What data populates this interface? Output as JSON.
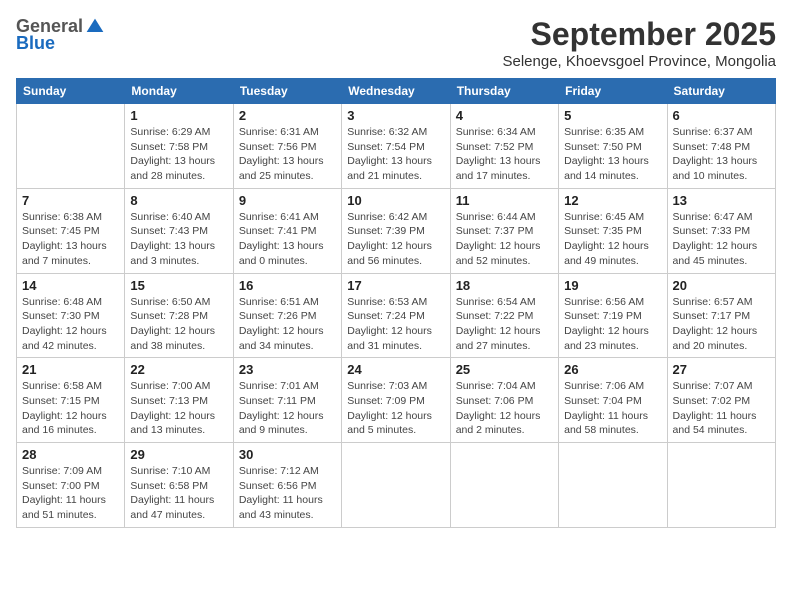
{
  "header": {
    "logo_general": "General",
    "logo_blue": "Blue",
    "month_title": "September 2025",
    "subtitle": "Selenge, Khoevsgoel Province, Mongolia"
  },
  "days_of_week": [
    "Sunday",
    "Monday",
    "Tuesday",
    "Wednesday",
    "Thursday",
    "Friday",
    "Saturday"
  ],
  "weeks": [
    [
      {
        "day": "",
        "info": ""
      },
      {
        "day": "1",
        "info": "Sunrise: 6:29 AM\nSunset: 7:58 PM\nDaylight: 13 hours\nand 28 minutes."
      },
      {
        "day": "2",
        "info": "Sunrise: 6:31 AM\nSunset: 7:56 PM\nDaylight: 13 hours\nand 25 minutes."
      },
      {
        "day": "3",
        "info": "Sunrise: 6:32 AM\nSunset: 7:54 PM\nDaylight: 13 hours\nand 21 minutes."
      },
      {
        "day": "4",
        "info": "Sunrise: 6:34 AM\nSunset: 7:52 PM\nDaylight: 13 hours\nand 17 minutes."
      },
      {
        "day": "5",
        "info": "Sunrise: 6:35 AM\nSunset: 7:50 PM\nDaylight: 13 hours\nand 14 minutes."
      },
      {
        "day": "6",
        "info": "Sunrise: 6:37 AM\nSunset: 7:48 PM\nDaylight: 13 hours\nand 10 minutes."
      }
    ],
    [
      {
        "day": "7",
        "info": "Sunrise: 6:38 AM\nSunset: 7:45 PM\nDaylight: 13 hours\nand 7 minutes."
      },
      {
        "day": "8",
        "info": "Sunrise: 6:40 AM\nSunset: 7:43 PM\nDaylight: 13 hours\nand 3 minutes."
      },
      {
        "day": "9",
        "info": "Sunrise: 6:41 AM\nSunset: 7:41 PM\nDaylight: 13 hours\nand 0 minutes."
      },
      {
        "day": "10",
        "info": "Sunrise: 6:42 AM\nSunset: 7:39 PM\nDaylight: 12 hours\nand 56 minutes."
      },
      {
        "day": "11",
        "info": "Sunrise: 6:44 AM\nSunset: 7:37 PM\nDaylight: 12 hours\nand 52 minutes."
      },
      {
        "day": "12",
        "info": "Sunrise: 6:45 AM\nSunset: 7:35 PM\nDaylight: 12 hours\nand 49 minutes."
      },
      {
        "day": "13",
        "info": "Sunrise: 6:47 AM\nSunset: 7:33 PM\nDaylight: 12 hours\nand 45 minutes."
      }
    ],
    [
      {
        "day": "14",
        "info": "Sunrise: 6:48 AM\nSunset: 7:30 PM\nDaylight: 12 hours\nand 42 minutes."
      },
      {
        "day": "15",
        "info": "Sunrise: 6:50 AM\nSunset: 7:28 PM\nDaylight: 12 hours\nand 38 minutes."
      },
      {
        "day": "16",
        "info": "Sunrise: 6:51 AM\nSunset: 7:26 PM\nDaylight: 12 hours\nand 34 minutes."
      },
      {
        "day": "17",
        "info": "Sunrise: 6:53 AM\nSunset: 7:24 PM\nDaylight: 12 hours\nand 31 minutes."
      },
      {
        "day": "18",
        "info": "Sunrise: 6:54 AM\nSunset: 7:22 PM\nDaylight: 12 hours\nand 27 minutes."
      },
      {
        "day": "19",
        "info": "Sunrise: 6:56 AM\nSunset: 7:19 PM\nDaylight: 12 hours\nand 23 minutes."
      },
      {
        "day": "20",
        "info": "Sunrise: 6:57 AM\nSunset: 7:17 PM\nDaylight: 12 hours\nand 20 minutes."
      }
    ],
    [
      {
        "day": "21",
        "info": "Sunrise: 6:58 AM\nSunset: 7:15 PM\nDaylight: 12 hours\nand 16 minutes."
      },
      {
        "day": "22",
        "info": "Sunrise: 7:00 AM\nSunset: 7:13 PM\nDaylight: 12 hours\nand 13 minutes."
      },
      {
        "day": "23",
        "info": "Sunrise: 7:01 AM\nSunset: 7:11 PM\nDaylight: 12 hours\nand 9 minutes."
      },
      {
        "day": "24",
        "info": "Sunrise: 7:03 AM\nSunset: 7:09 PM\nDaylight: 12 hours\nand 5 minutes."
      },
      {
        "day": "25",
        "info": "Sunrise: 7:04 AM\nSunset: 7:06 PM\nDaylight: 12 hours\nand 2 minutes."
      },
      {
        "day": "26",
        "info": "Sunrise: 7:06 AM\nSunset: 7:04 PM\nDaylight: 11 hours\nand 58 minutes."
      },
      {
        "day": "27",
        "info": "Sunrise: 7:07 AM\nSunset: 7:02 PM\nDaylight: 11 hours\nand 54 minutes."
      }
    ],
    [
      {
        "day": "28",
        "info": "Sunrise: 7:09 AM\nSunset: 7:00 PM\nDaylight: 11 hours\nand 51 minutes."
      },
      {
        "day": "29",
        "info": "Sunrise: 7:10 AM\nSunset: 6:58 PM\nDaylight: 11 hours\nand 47 minutes."
      },
      {
        "day": "30",
        "info": "Sunrise: 7:12 AM\nSunset: 6:56 PM\nDaylight: 11 hours\nand 43 minutes."
      },
      {
        "day": "",
        "info": ""
      },
      {
        "day": "",
        "info": ""
      },
      {
        "day": "",
        "info": ""
      },
      {
        "day": "",
        "info": ""
      }
    ]
  ]
}
